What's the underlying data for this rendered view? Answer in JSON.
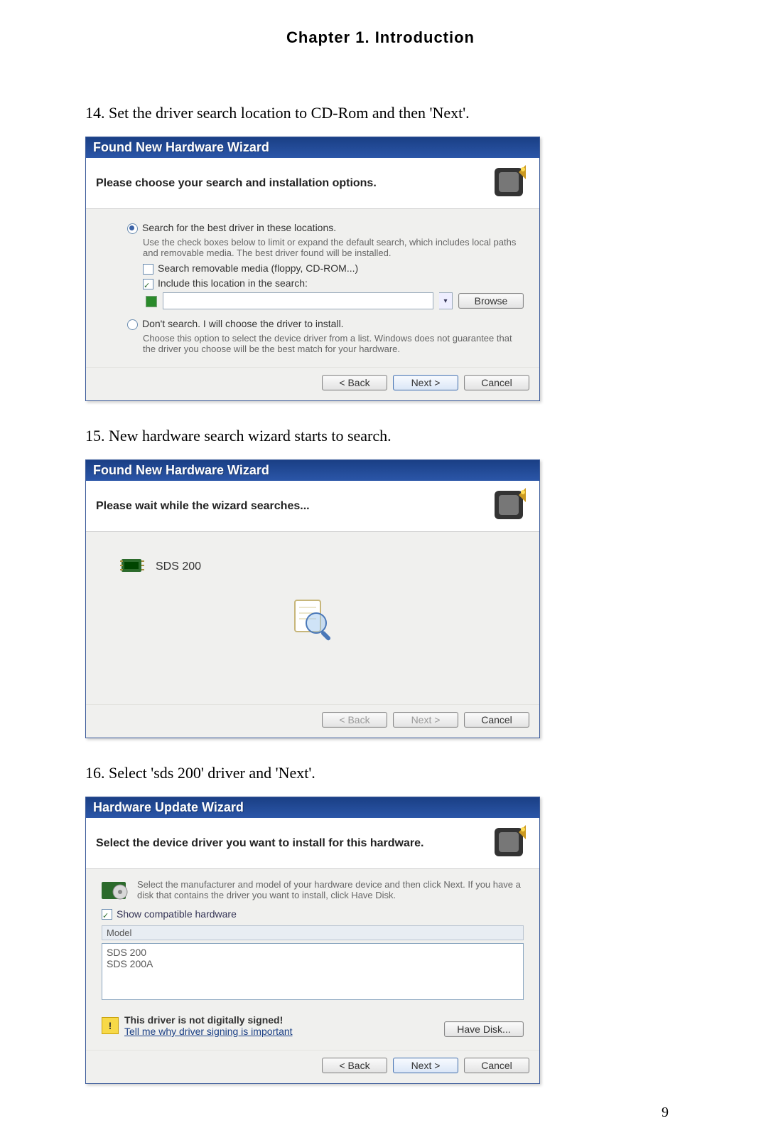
{
  "chapter_title": "Chapter 1. Introduction",
  "page_number": "9",
  "steps": {
    "s14": "14. Set the driver search location to CD-Rom and then 'Next'.",
    "s15": "15. New hardware search wizard starts to search.",
    "s16": "16. Select 'sds 200' driver and 'Next'."
  },
  "wizard1": {
    "title": "Found New Hardware Wizard",
    "header": "Please choose your search and installation options.",
    "opt1_label": "Search for the best driver in these locations.",
    "opt1_desc": "Use the check boxes below to limit or expand the default search, which includes local paths and removable media. The best driver found will be installed.",
    "chk_media": "Search removable media (floppy, CD-ROM...)",
    "chk_include": "Include this location in the search:",
    "browse": "Browse",
    "opt2_label": "Don't search. I will choose the driver to install.",
    "opt2_desc": "Choose this option to select the device driver from a list. Windows does not guarantee that the driver you choose will be the best match for your hardware.",
    "back": "< Back",
    "next": "Next >",
    "cancel": "Cancel"
  },
  "wizard2": {
    "title": "Found New Hardware Wizard",
    "header": "Please wait while the wizard searches...",
    "device": "SDS 200",
    "back": "< Back",
    "next": "Next >",
    "cancel": "Cancel"
  },
  "wizard3": {
    "title": "Hardware Update Wizard",
    "header": "Select the device driver you want to install for this hardware.",
    "instruction": "Select the manufacturer and model of your hardware device and then click Next. If you have a disk that contains the driver you want to install, click Have Disk.",
    "compat_label": "Show compatible hardware",
    "list_header": "Model",
    "item1": "SDS 200",
    "item2": "SDS 200A",
    "not_signed": "This driver is not digitally signed!",
    "tell_me": "Tell me why driver signing is important",
    "have_disk": "Have Disk...",
    "back": "< Back",
    "next": "Next >",
    "cancel": "Cancel"
  }
}
